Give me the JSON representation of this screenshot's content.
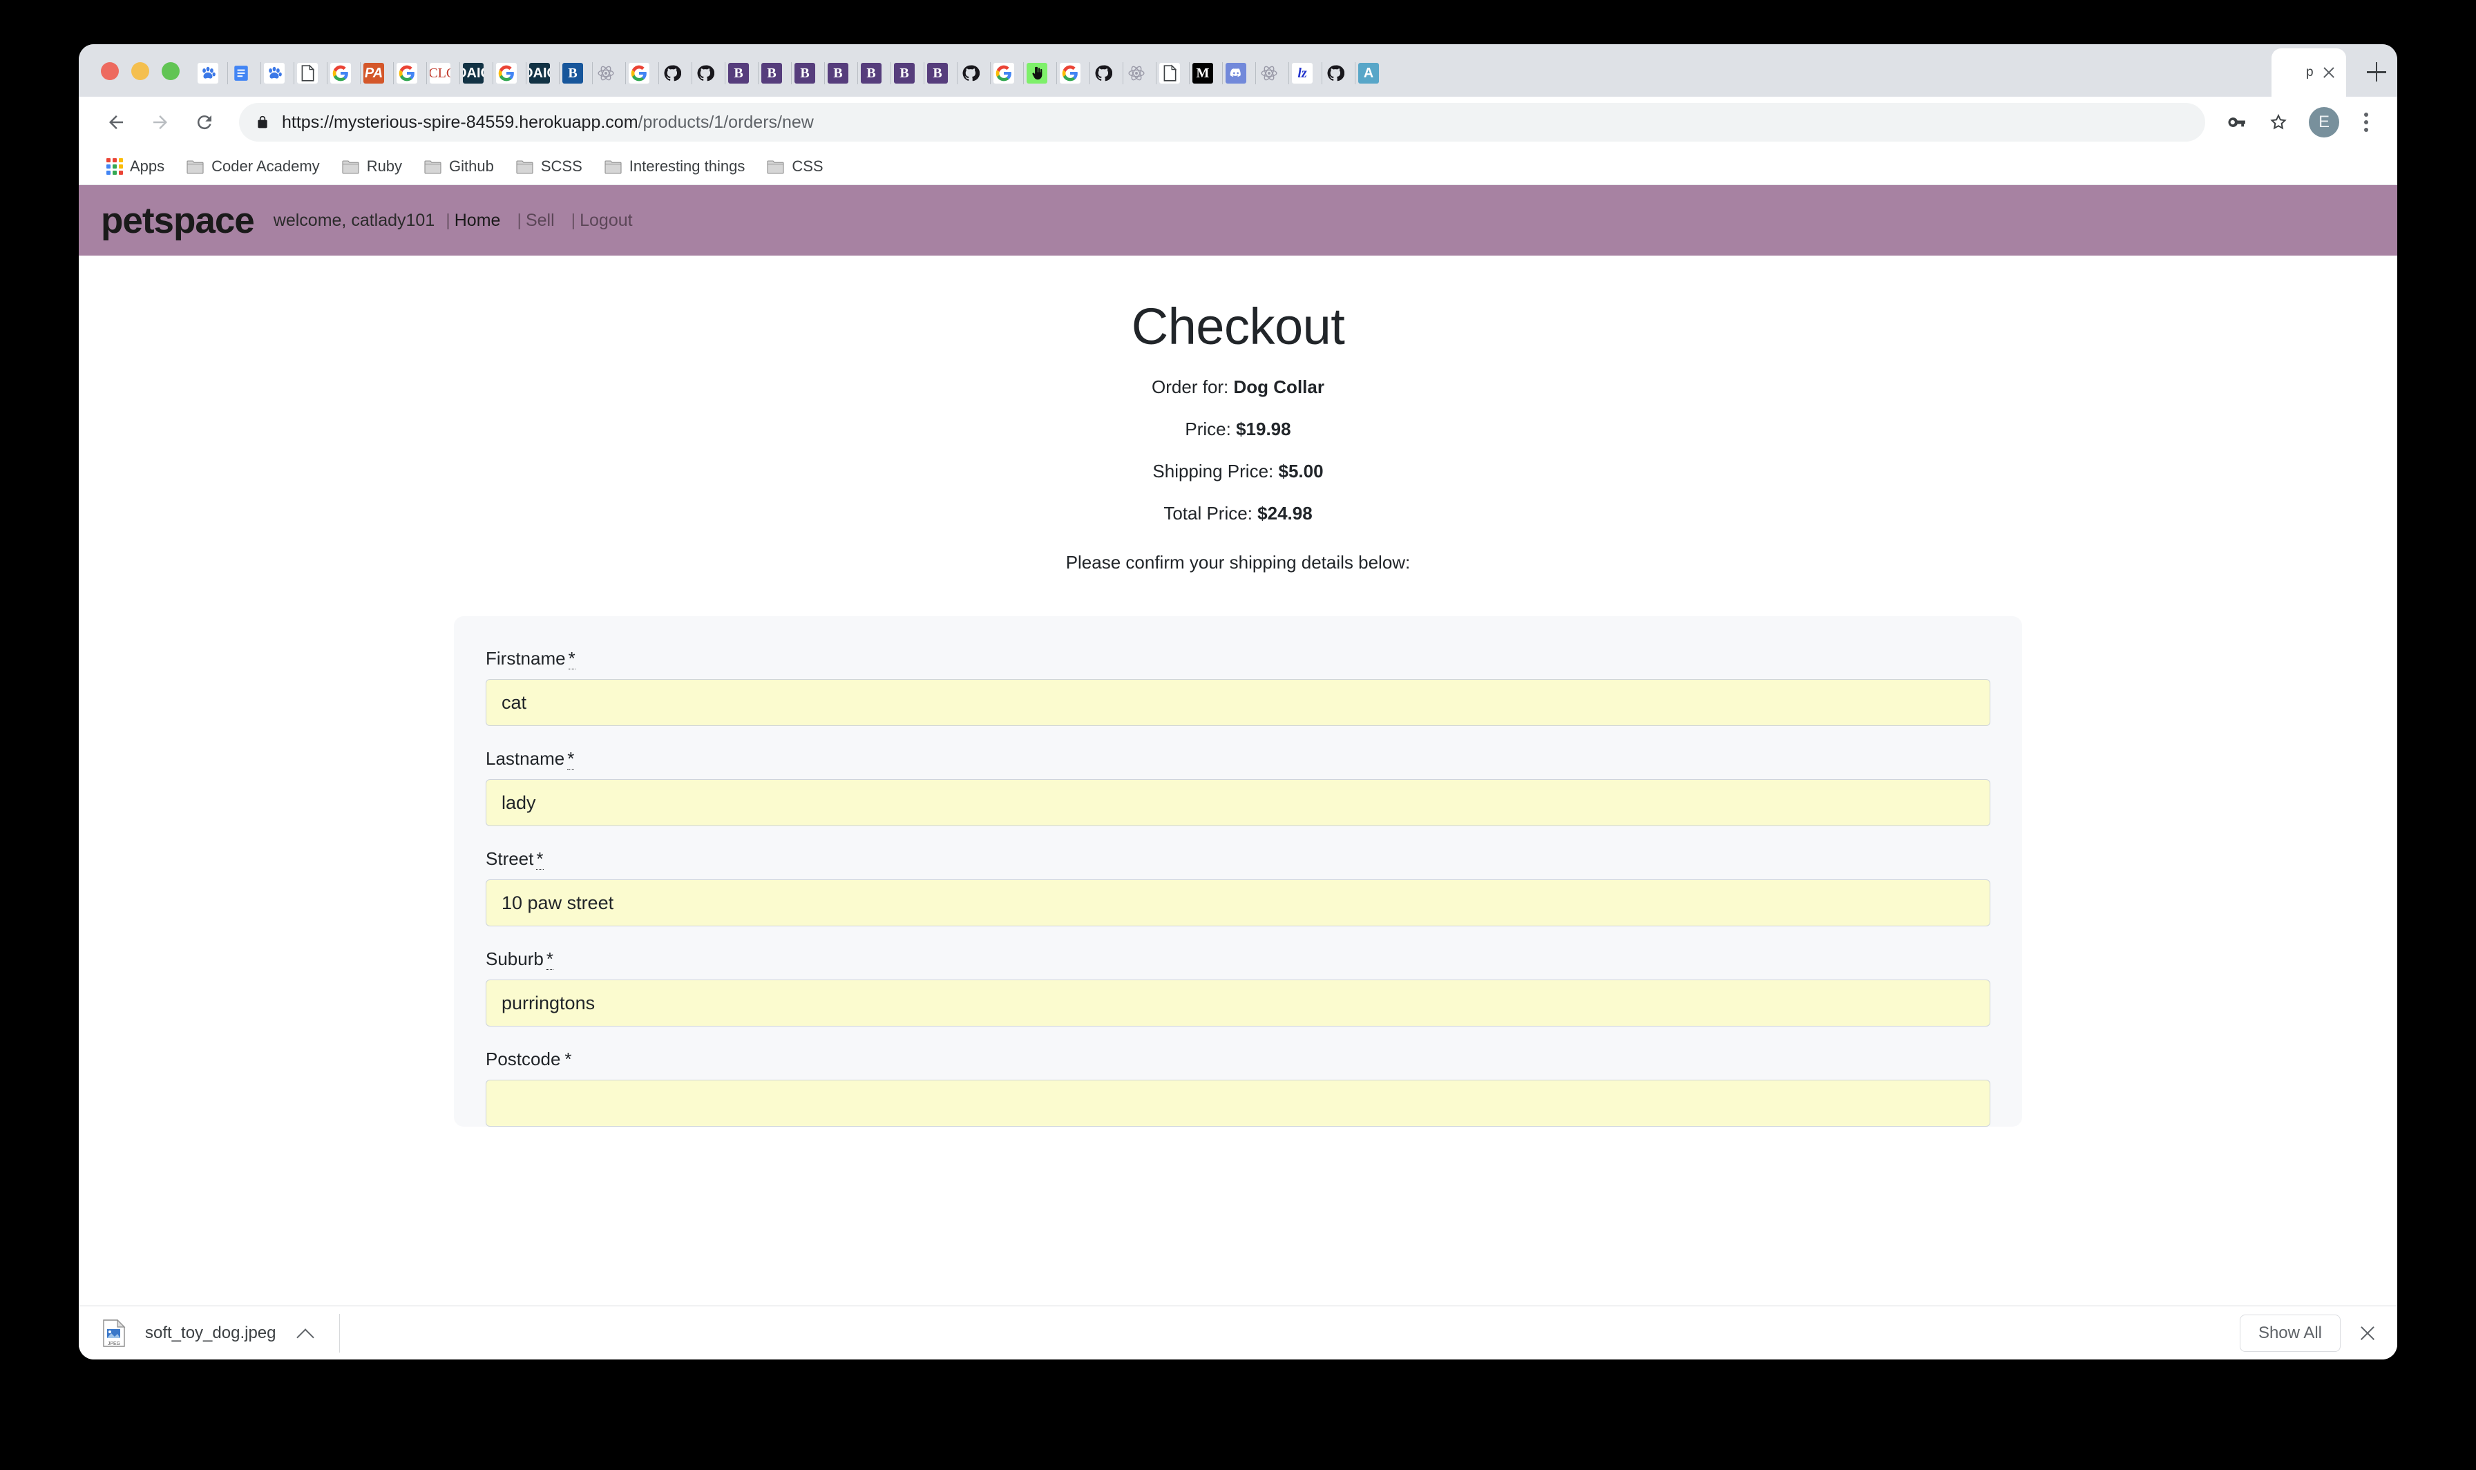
{
  "browser": {
    "window_controls": [
      "close",
      "minimize",
      "maximize"
    ],
    "tabs": [
      {
        "icon": "paw-icon"
      },
      {
        "icon": "google-docs-icon"
      },
      {
        "icon": "paw-icon"
      },
      {
        "icon": "file-icon"
      },
      {
        "icon": "google-icon"
      },
      {
        "icon": "pa-icon"
      },
      {
        "icon": "google-icon"
      },
      {
        "icon": "iclg-icon"
      },
      {
        "icon": "oaic-icon"
      },
      {
        "icon": "google-icon"
      },
      {
        "icon": "oaic-icon"
      },
      {
        "icon": "b-blue-icon"
      },
      {
        "icon": "atom-icon"
      },
      {
        "icon": "google-icon"
      },
      {
        "icon": "github-icon"
      },
      {
        "icon": "github-icon"
      },
      {
        "icon": "bootstrap-icon"
      },
      {
        "icon": "bootstrap-icon"
      },
      {
        "icon": "bootstrap-icon"
      },
      {
        "icon": "bootstrap-icon"
      },
      {
        "icon": "bootstrap-icon"
      },
      {
        "icon": "bootstrap-icon"
      },
      {
        "icon": "bootstrap-icon"
      },
      {
        "icon": "github-icon"
      },
      {
        "icon": "google-icon"
      },
      {
        "icon": "hand-green-icon"
      },
      {
        "icon": "google-icon"
      },
      {
        "icon": "github-icon"
      },
      {
        "icon": "atom-icon"
      },
      {
        "icon": "file-icon"
      },
      {
        "icon": "medium-icon"
      },
      {
        "icon": "discord-icon"
      },
      {
        "icon": "atom-icon"
      },
      {
        "icon": "lz-icon"
      },
      {
        "icon": "github-icon"
      },
      {
        "icon": "aa-icon"
      }
    ],
    "active_tab": {
      "title": "p",
      "icon": "petspace-icon"
    },
    "new_tab_label": "+",
    "toolbar": {
      "back_label": "Back",
      "forward_label": "Forward",
      "reload_label": "Reload",
      "url_scheme_host": "https://mysterious-spire-84559.herokuapp.com",
      "url_path": "/products/1/orders/new",
      "avatar_initial": "E"
    },
    "bookmarks": [
      {
        "label": "Apps",
        "icon": "apps-grid-icon"
      },
      {
        "label": "Coder Academy",
        "icon": "folder-icon"
      },
      {
        "label": "Ruby",
        "icon": "folder-icon"
      },
      {
        "label": "Github",
        "icon": "folder-icon"
      },
      {
        "label": "SCSS",
        "icon": "folder-icon"
      },
      {
        "label": "Interesting things",
        "icon": "folder-icon"
      },
      {
        "label": "CSS",
        "icon": "folder-icon"
      }
    ],
    "download_shelf": {
      "filename": "soft_toy_dog.jpeg",
      "file_type_badge": "JPEG",
      "show_all_label": "Show All",
      "close_label": "Close"
    }
  },
  "site": {
    "logo": "petspace",
    "welcome": "welcome, catlady101",
    "nav": [
      {
        "sep": "|",
        "label": "Home",
        "active": true
      },
      {
        "sep": "|",
        "label": "Sell",
        "active": false
      },
      {
        "sep": "|",
        "label": "Logout",
        "active": false
      }
    ],
    "header_color": "#a782a2"
  },
  "checkout": {
    "title": "Checkout",
    "order_for_label": "Order for:",
    "order_for_value": "Dog Collar",
    "price_label": "Price:",
    "price_value": "$19.98",
    "shipping_label": "Shipping Price:",
    "shipping_value": "$5.00",
    "total_label": "Total Price:",
    "total_value": "$24.98",
    "confirm_text": "Please confirm your shipping details below:"
  },
  "form": {
    "required_marker": "*",
    "fields": [
      {
        "label": "Firstname",
        "value": "cat",
        "required": true
      },
      {
        "label": "Lastname",
        "value": "lady",
        "required": true
      },
      {
        "label": "Street",
        "value": "10 paw street",
        "required": true
      },
      {
        "label": "Suburb",
        "value": "purringtons",
        "required": true
      },
      {
        "label": "Postcode",
        "value": "",
        "required": true
      }
    ],
    "autofill_color": "#fbfbcf"
  }
}
